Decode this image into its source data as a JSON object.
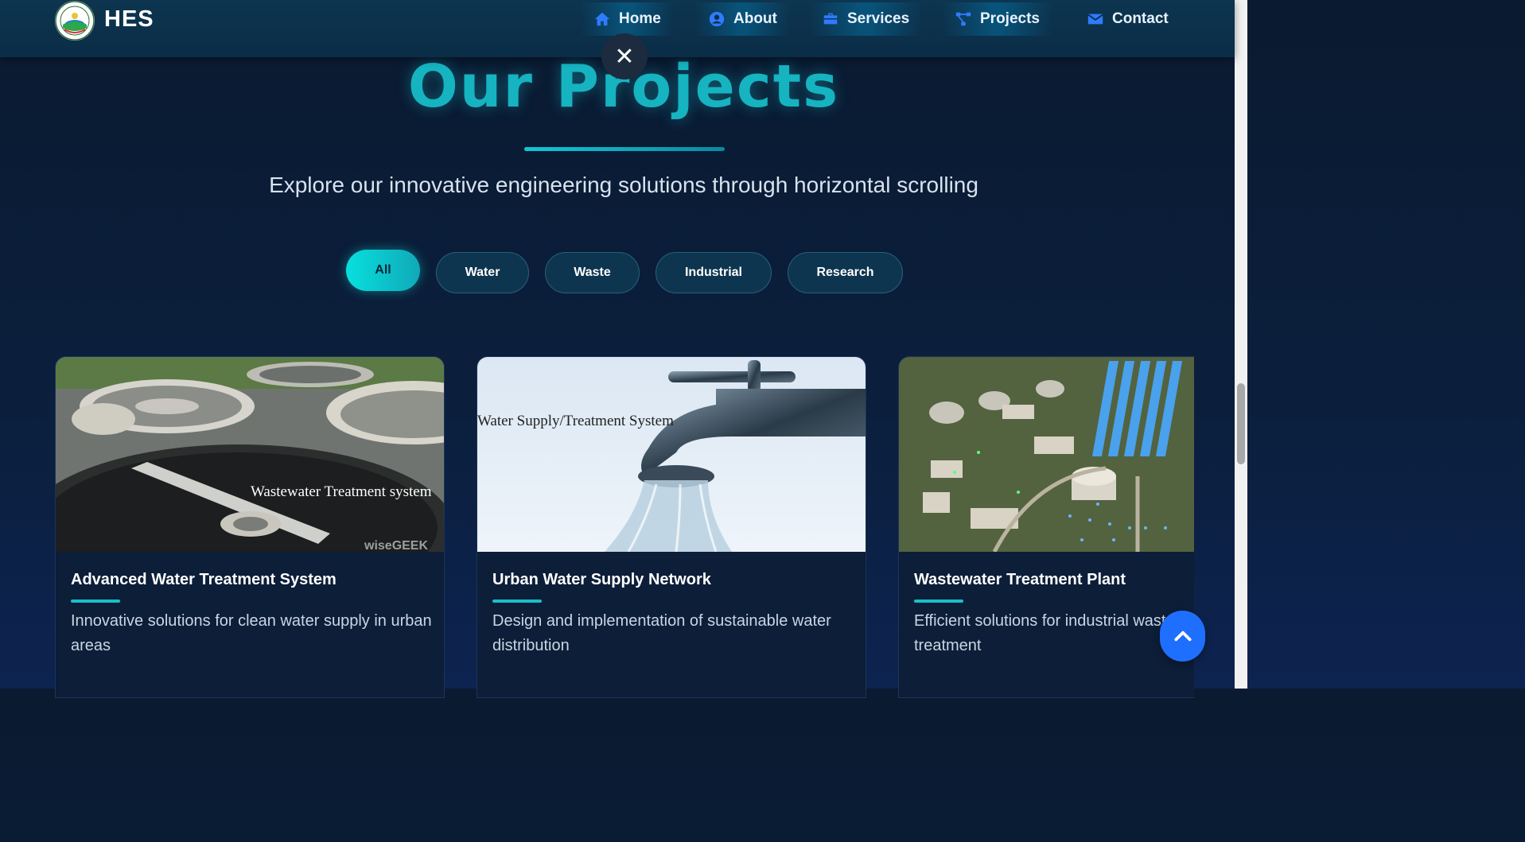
{
  "header": {
    "brand": "HES",
    "nav": [
      {
        "label": "Home",
        "icon": "home-icon"
      },
      {
        "label": "About",
        "icon": "user-circle-icon"
      },
      {
        "label": "Services",
        "icon": "briefcase-icon"
      },
      {
        "label": "Projects",
        "icon": "project-diagram-icon"
      },
      {
        "label": "Contact",
        "icon": "envelope-icon"
      }
    ]
  },
  "close_button": {
    "icon": "close-icon",
    "glyph": "✕"
  },
  "hero": {
    "title": "Our Projects",
    "subtitle": "Explore our innovative engineering solutions through horizontal scrolling"
  },
  "filters": {
    "active": "All",
    "items": [
      "All",
      "Water",
      "Waste",
      "Industrial",
      "Research"
    ]
  },
  "projects": [
    {
      "title": "Advanced Water Treatment System",
      "description": "Innovative solutions for clean water supply in urban areas",
      "image_caption": "Wastewater Treatment system",
      "image_watermark": "wiseGEEK"
    },
    {
      "title": "Urban Water Supply Network",
      "description": "Design and implementation of sustainable water distribution",
      "image_caption": "Water Supply/Treatment System"
    },
    {
      "title": "Wastewater Treatment Plant",
      "description": "Efficient solutions for industrial waste treatment"
    }
  ],
  "back_to_top": {
    "icon": "chevron-up-icon"
  },
  "colors": {
    "accent": "#16b3c1",
    "nav_icon": "#2f7bff",
    "button_blue": "#1f6fff",
    "background": "#0b1f3d"
  }
}
